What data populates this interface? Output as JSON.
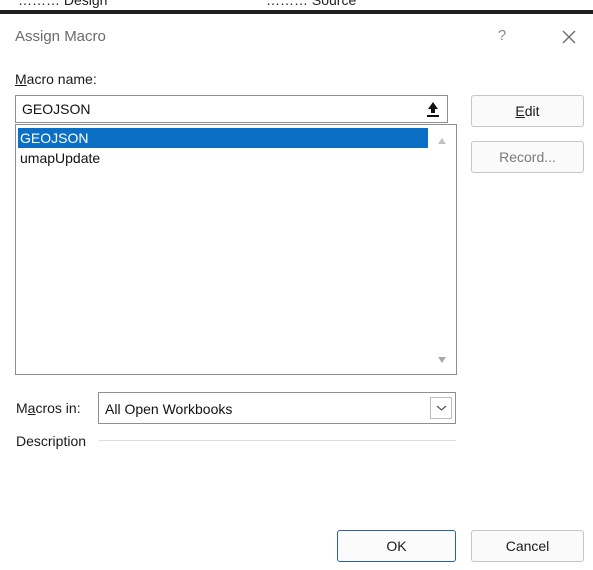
{
  "dialog": {
    "title": "Assign Macro",
    "help_label": "?"
  },
  "background_fragments": {
    "left": "……… Design",
    "right": "……… Source"
  },
  "macro_name": {
    "label_accel": "M",
    "label_rest": "acro name:",
    "value": "GEOJSON"
  },
  "macro_list": {
    "items": [
      "GEOJSON",
      "umapUpdate"
    ],
    "selected_index": 0
  },
  "buttons": {
    "edit_accel": "E",
    "edit_rest": "dit",
    "record": "Record...",
    "ok": "OK",
    "cancel": "Cancel"
  },
  "macros_in": {
    "label_pre": "M",
    "label_accel": "a",
    "label_rest": "cros in:",
    "value": "All Open Workbooks"
  },
  "description": {
    "label": "Description"
  },
  "icons": {
    "upload": "collapse-arrow-icon",
    "close": "close-icon",
    "dropdown": "chevron-down-icon"
  }
}
